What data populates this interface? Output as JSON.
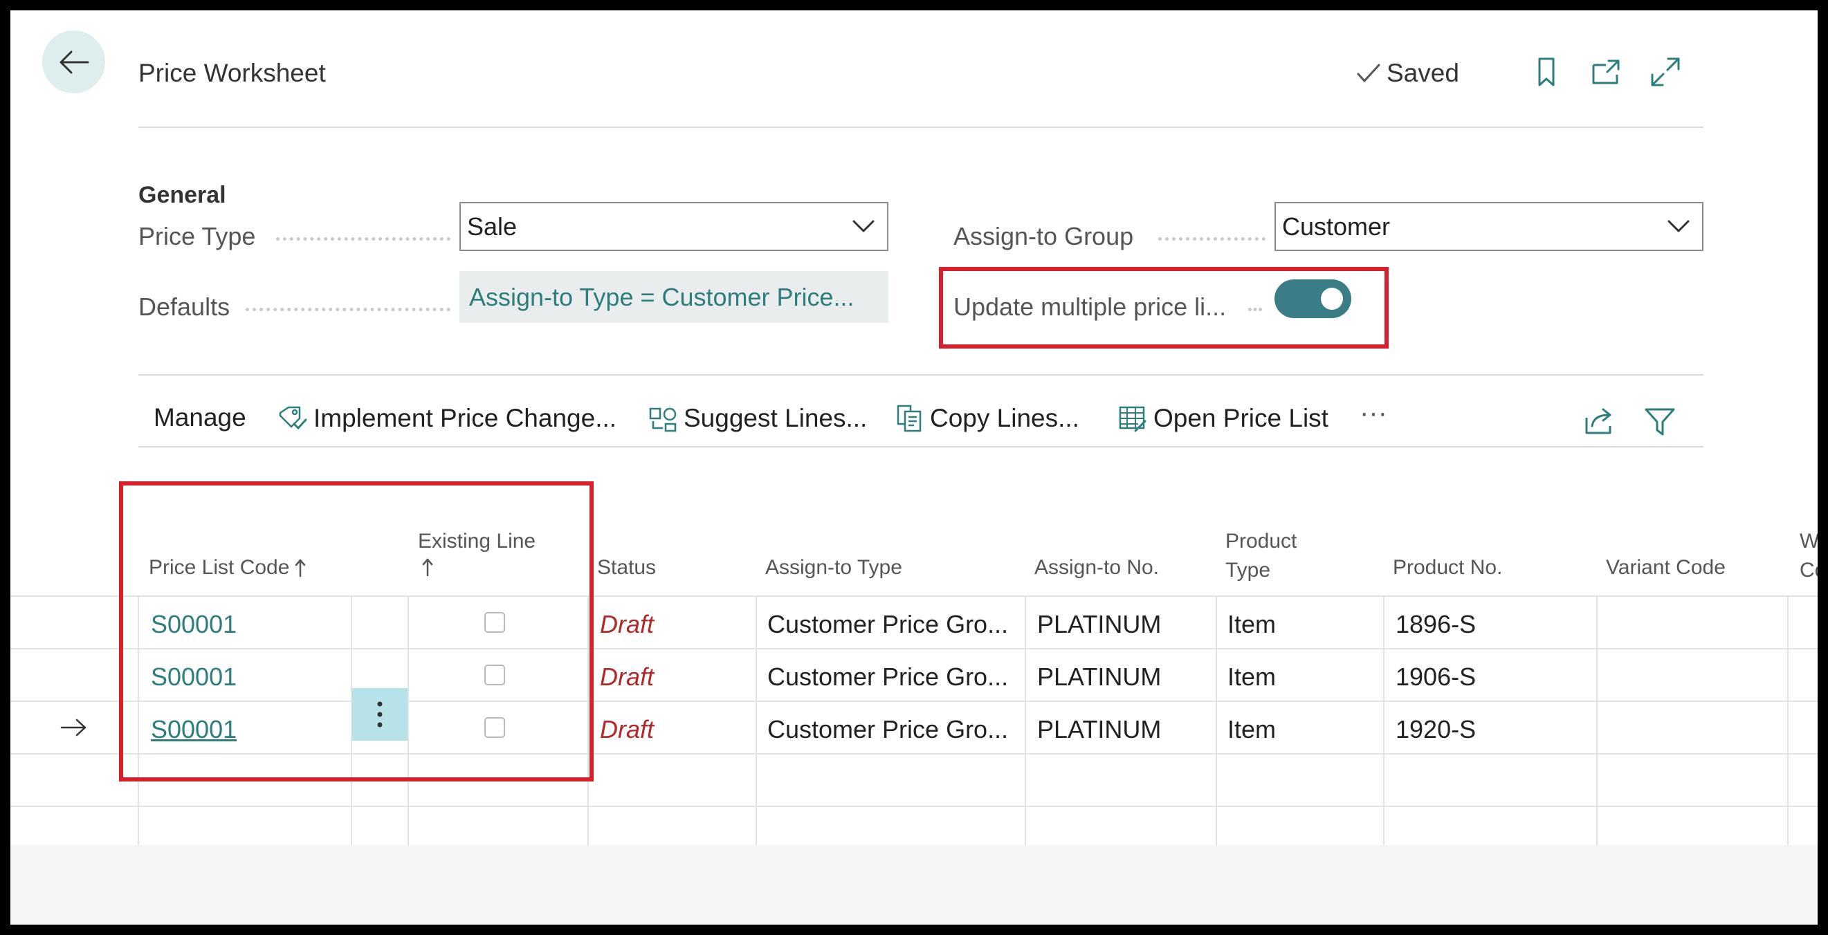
{
  "header": {
    "title": "Price Worksheet",
    "saved_label": "Saved"
  },
  "general": {
    "section_title": "General",
    "price_type": {
      "label": "Price Type",
      "value": "Sale"
    },
    "assign_to_group": {
      "label": "Assign-to Group",
      "value": "Customer"
    },
    "defaults": {
      "label": "Defaults",
      "value": "Assign-to Type = Customer Price..."
    },
    "update_multiple": {
      "label": "Update multiple price li...",
      "enabled": true
    }
  },
  "actions": {
    "manage": "Manage",
    "implement": "Implement Price Change...",
    "suggest": "Suggest Lines...",
    "copy": "Copy Lines...",
    "open_price_list": "Open Price List",
    "more": "···"
  },
  "grid": {
    "columns": {
      "price_list_code": "Price List Code",
      "existing_line": "Existing Line",
      "status": "Status",
      "assign_to_type": "Assign-to Type",
      "assign_to_no": "Assign-to No.",
      "product_type_1": "Product",
      "product_type_2": "Type",
      "product_no": "Product No.",
      "variant_code": "Variant Code",
      "cut_1": "W",
      "cut_2": "Co"
    },
    "rows": [
      {
        "code": "S00001",
        "existing": false,
        "status": "Draft",
        "assign_type": "Customer Price Gro...",
        "assign_no": "PLATINUM",
        "product_type": "Item",
        "product_no": "1896-S",
        "variant": ""
      },
      {
        "code": "S00001",
        "existing": false,
        "status": "Draft",
        "assign_type": "Customer Price Gro...",
        "assign_no": "PLATINUM",
        "product_type": "Item",
        "product_no": "1906-S",
        "variant": ""
      },
      {
        "code": "S00001",
        "existing": false,
        "status": "Draft",
        "assign_type": "Customer Price Gro...",
        "assign_no": "PLATINUM",
        "product_type": "Item",
        "product_no": "1920-S",
        "variant": ""
      }
    ]
  },
  "colors": {
    "accent": "#2e7d7d",
    "toggle_on": "#3a7d86",
    "draft": "#b02a2a",
    "highlight": "#d81f2c",
    "row_menu": "#b6e3ea"
  }
}
